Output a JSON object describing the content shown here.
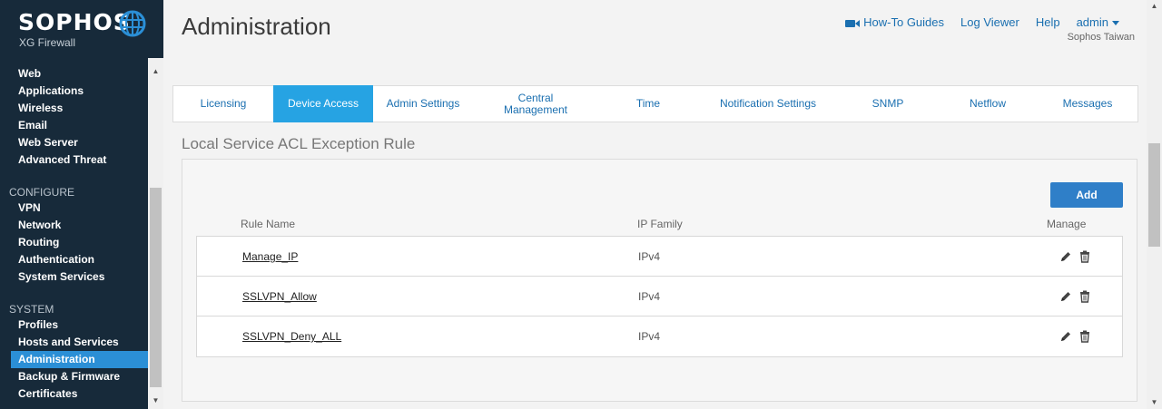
{
  "brand": {
    "name": "SOPHOS",
    "product": "XG Firewall"
  },
  "sidebar": {
    "items_top": [
      {
        "label": "Web"
      },
      {
        "label": "Applications"
      },
      {
        "label": "Wireless"
      },
      {
        "label": "Email"
      },
      {
        "label": "Web Server"
      },
      {
        "label": "Advanced Threat"
      }
    ],
    "configure_label": "CONFIGURE",
    "configure_items": [
      {
        "label": "VPN"
      },
      {
        "label": "Network"
      },
      {
        "label": "Routing"
      },
      {
        "label": "Authentication"
      },
      {
        "label": "System Services"
      }
    ],
    "system_label": "SYSTEM",
    "system_items": [
      {
        "label": "Profiles"
      },
      {
        "label": "Hosts and Services"
      },
      {
        "label": "Administration"
      },
      {
        "label": "Backup & Firmware"
      },
      {
        "label": "Certificates"
      }
    ],
    "active_item": "Administration"
  },
  "header": {
    "title": "Administration",
    "links": {
      "how_to": "How-To Guides",
      "log_viewer": "Log Viewer",
      "help": "Help",
      "user": "admin"
    },
    "org": "Sophos Taiwan"
  },
  "tabs": [
    {
      "label": "Licensing"
    },
    {
      "label": "Device Access"
    },
    {
      "label": "Admin Settings"
    },
    {
      "label": "Central Management"
    },
    {
      "label": "Time"
    },
    {
      "label": "Notification Settings"
    },
    {
      "label": "SNMP"
    },
    {
      "label": "Netflow"
    },
    {
      "label": "Messages"
    }
  ],
  "active_tab": "Device Access",
  "section": {
    "title": "Local Service ACL Exception Rule",
    "add_label": "Add",
    "columns": {
      "rule_name": "Rule Name",
      "ip_family": "IP Family",
      "manage": "Manage"
    },
    "rows": [
      {
        "name": "Manage_IP",
        "ip_family": "IPv4"
      },
      {
        "name": "SSLVPN_Allow",
        "ip_family": "IPv4"
      },
      {
        "name": "SSLVPN_Deny_ALL",
        "ip_family": "IPv4"
      }
    ]
  },
  "colors": {
    "sidebar_bg": "#172a3a",
    "active_nav": "#2b8fd6",
    "active_tab": "#26a3e3",
    "link": "#1a6fb0",
    "add_button": "#2f7fc8"
  }
}
